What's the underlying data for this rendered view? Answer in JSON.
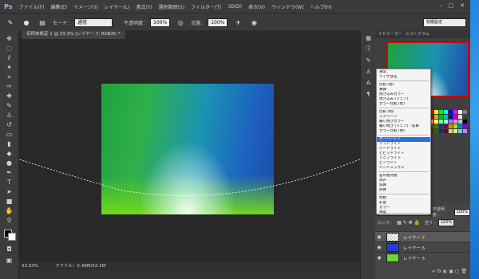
{
  "app": {
    "logo": "Ps",
    "menu": [
      "ファイル(F)",
      "編集(E)",
      "イメージ(I)",
      "レイヤー(L)",
      "書式(Y)",
      "選択範囲(S)",
      "フィルター(T)",
      "3D(D)",
      "表示(V)",
      "ウィンドウ(W)",
      "ヘルプ(H)"
    ]
  },
  "options": {
    "mode_label": "モード：",
    "mode_value": "通常",
    "opacity_label": "不透明度：",
    "opacity_value": "100%",
    "flow_label": "流量：",
    "flow_value": "100%",
    "workspace": "初期設定"
  },
  "document": {
    "tab_title": "名称未設定 1 @ 33.3% (レイヤー 7, RGB/8) *",
    "zoom": "33.33%",
    "file_info": "ファイル：5.49M/52.2M"
  },
  "panels": {
    "tabs": [
      "ナビゲーター",
      "ヒストグラム"
    ],
    "layers": {
      "blend_value": "通常",
      "opacity_label": "不透明度：",
      "opacity_value": "100%",
      "lock_label": "ロック：",
      "fill_label": "塗り：",
      "fill_value": "100%",
      "items": [
        {
          "name": "レイヤー 7",
          "thumb": "transparent"
        },
        {
          "name": "レイヤー 6",
          "thumb": "#1f3fd0"
        },
        {
          "name": "レイヤー 5",
          "thumb": "#6fd63a"
        }
      ]
    }
  },
  "blend_menu": {
    "items": [
      "通常",
      "ディザ合成",
      "比較 (暗)",
      "乗算",
      "焼き込みカラー",
      "焼き込み (リニア)",
      "カラー比較 (暗)",
      "比較 (明)",
      "スクリーン",
      "覆い焼きカラー",
      "覆い焼き (リニア) - 加算",
      "カラー比較 (明)",
      "オーバーレイ",
      "ソフトライト",
      "ハードライト",
      "ビビッドライト",
      "リニアライト",
      "ピンライト",
      "ハードミックス",
      "差の絶対値",
      "除外",
      "減算",
      "除算",
      "色相",
      "彩度",
      "カラー",
      "輝度"
    ],
    "selected": "オーバーレイ"
  },
  "colors": {
    "app_bg": "#323232",
    "accent": "#2f6fdc",
    "swatches": [
      "#ff0000",
      "#ffff00",
      "#00ff00",
      "#00ffff",
      "#0000ff",
      "#ff00ff",
      "#ffffff",
      "#808080",
      "#c00000",
      "#c0c000",
      "#00c000",
      "#00c0c0",
      "#0000c0",
      "#c000c0",
      "#e0e0e0",
      "#404040",
      "#ff8080",
      "#ffff80",
      "#80ff80",
      "#80ffff",
      "#8080ff",
      "#ff80ff",
      "#c0c0c0",
      "#000000",
      "#804000",
      "#408000",
      "#004080",
      "#800040",
      "#ff8000",
      "#80ff00",
      "#0080ff",
      "#8000ff",
      "#603000",
      "#306000",
      "#003060",
      "#600030",
      "#ffc080",
      "#c0ff80",
      "#80c0ff",
      "#c080ff"
    ]
  }
}
